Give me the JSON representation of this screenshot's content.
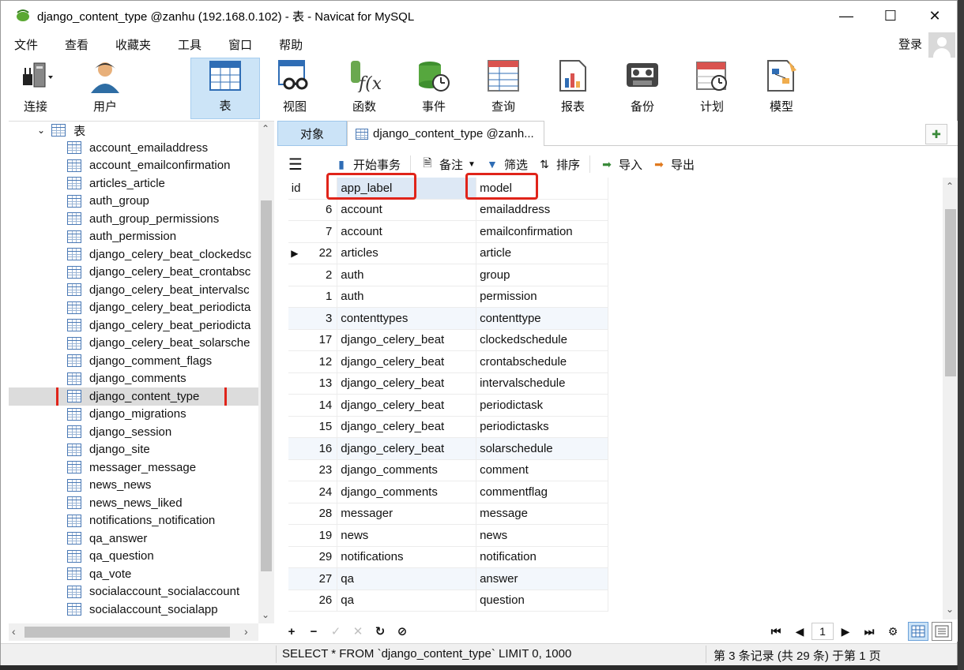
{
  "window": {
    "title": "django_content_type @zanhu (192.168.0.102) - 表 - Navicat for MySQL",
    "min_symbol": "—",
    "max_symbol": "☐",
    "close_symbol": "✕"
  },
  "menu": {
    "items": [
      "文件",
      "查看",
      "收藏夹",
      "工具",
      "窗口",
      "帮助"
    ],
    "login": "登录"
  },
  "toolbar": {
    "items": [
      {
        "label": "连接",
        "icon": "plug-icon"
      },
      {
        "label": "用户",
        "icon": "user-icon"
      },
      {
        "label": "表",
        "icon": "table-icon"
      },
      {
        "label": "视图",
        "icon": "view-icon"
      },
      {
        "label": "函数",
        "icon": "function-icon"
      },
      {
        "label": "事件",
        "icon": "event-icon"
      },
      {
        "label": "查询",
        "icon": "query-icon"
      },
      {
        "label": "报表",
        "icon": "report-icon"
      },
      {
        "label": "备份",
        "icon": "backup-icon"
      },
      {
        "label": "计划",
        "icon": "schedule-icon"
      },
      {
        "label": "模型",
        "icon": "model-icon"
      }
    ],
    "active": "表"
  },
  "tree": {
    "header": "表",
    "items": [
      "account_emailaddress",
      "account_emailconfirmation",
      "articles_article",
      "auth_group",
      "auth_group_permissions",
      "auth_permission",
      "django_celery_beat_clockedsc",
      "django_celery_beat_crontabsc",
      "django_celery_beat_intervalsc",
      "django_celery_beat_periodicta",
      "django_celery_beat_periodicta",
      "django_celery_beat_solarsche",
      "django_comment_flags",
      "django_comments",
      "django_content_type",
      "django_migrations",
      "django_session",
      "django_site",
      "messager_message",
      "news_news",
      "news_news_liked",
      "notifications_notification",
      "qa_answer",
      "qa_question",
      "qa_vote",
      "socialaccount_socialaccount",
      "socialaccount_socialapp"
    ],
    "selected_index": 14
  },
  "tabs": {
    "objects": "对象",
    "active": "django_content_type @zanh..."
  },
  "gridtools": {
    "begin_transaction": "开始事务",
    "memo": "备注",
    "filter": "筛选",
    "sort": "排序",
    "import": "导入",
    "export": "导出"
  },
  "grid": {
    "columns": [
      "id",
      "app_label",
      "model"
    ],
    "rows": [
      {
        "id": "6",
        "app_label": "account",
        "model": "emailaddress"
      },
      {
        "id": "7",
        "app_label": "account",
        "model": "emailconfirmation"
      },
      {
        "id": "22",
        "app_label": "articles",
        "model": "article"
      },
      {
        "id": "2",
        "app_label": "auth",
        "model": "group"
      },
      {
        "id": "1",
        "app_label": "auth",
        "model": "permission"
      },
      {
        "id": "3",
        "app_label": "contenttypes",
        "model": "contenttype"
      },
      {
        "id": "17",
        "app_label": "django_celery_beat",
        "model": "clockedschedule"
      },
      {
        "id": "12",
        "app_label": "django_celery_beat",
        "model": "crontabschedule"
      },
      {
        "id": "13",
        "app_label": "django_celery_beat",
        "model": "intervalschedule"
      },
      {
        "id": "14",
        "app_label": "django_celery_beat",
        "model": "periodictask"
      },
      {
        "id": "15",
        "app_label": "django_celery_beat",
        "model": "periodictasks"
      },
      {
        "id": "16",
        "app_label": "django_celery_beat",
        "model": "solarschedule"
      },
      {
        "id": "23",
        "app_label": "django_comments",
        "model": "comment"
      },
      {
        "id": "24",
        "app_label": "django_comments",
        "model": "commentflag"
      },
      {
        "id": "28",
        "app_label": "messager",
        "model": "message"
      },
      {
        "id": "19",
        "app_label": "news",
        "model": "news"
      },
      {
        "id": "29",
        "app_label": "notifications",
        "model": "notification"
      },
      {
        "id": "27",
        "app_label": "qa",
        "model": "answer"
      },
      {
        "id": "26",
        "app_label": "qa",
        "model": "question"
      }
    ],
    "current_row": 2,
    "alt_rows": [
      5,
      11,
      17
    ]
  },
  "navbar": {
    "add": "+",
    "delete": "−",
    "apply": "✓",
    "discard": "✕",
    "refresh": "↻",
    "stop": "⊘",
    "page": "1"
  },
  "status": {
    "sql": "SELECT * FROM `django_content_type` LIMIT 0, 1000",
    "records": "第 3 条记录 (共 29 条) 于第 1 页"
  },
  "colors": {
    "accent": "#cce4f7",
    "highlight_box": "#e0241a",
    "table_icon": "#4a79b5"
  }
}
